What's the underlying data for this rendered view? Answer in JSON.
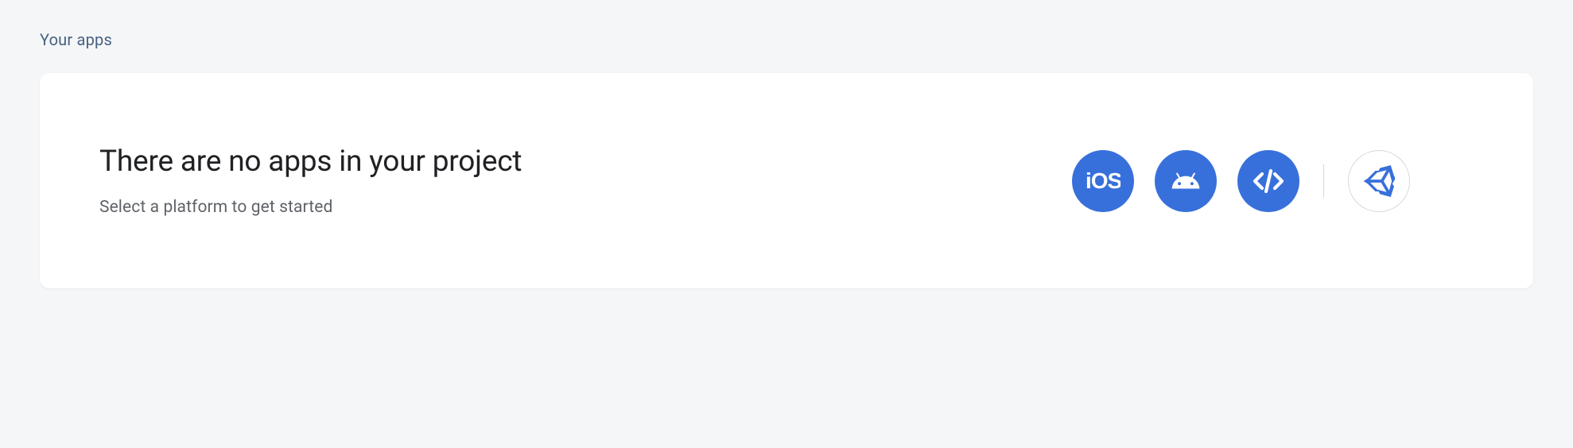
{
  "section": {
    "title": "Your apps"
  },
  "card": {
    "title": "There are no apps in your project",
    "subtitle": "Select a platform to get started"
  },
  "platforms": {
    "ios": {
      "label": "iOS",
      "icon": "ios-icon"
    },
    "android": {
      "label": "Android",
      "icon": "android-icon"
    },
    "web": {
      "label": "Web",
      "icon": "web-icon"
    },
    "unity": {
      "label": "Unity",
      "icon": "unity-icon"
    }
  },
  "colors": {
    "accent": "#3870db",
    "heading": "#476282",
    "text": "#202124",
    "muted": "#5f6368",
    "border": "#d6d7d9"
  }
}
